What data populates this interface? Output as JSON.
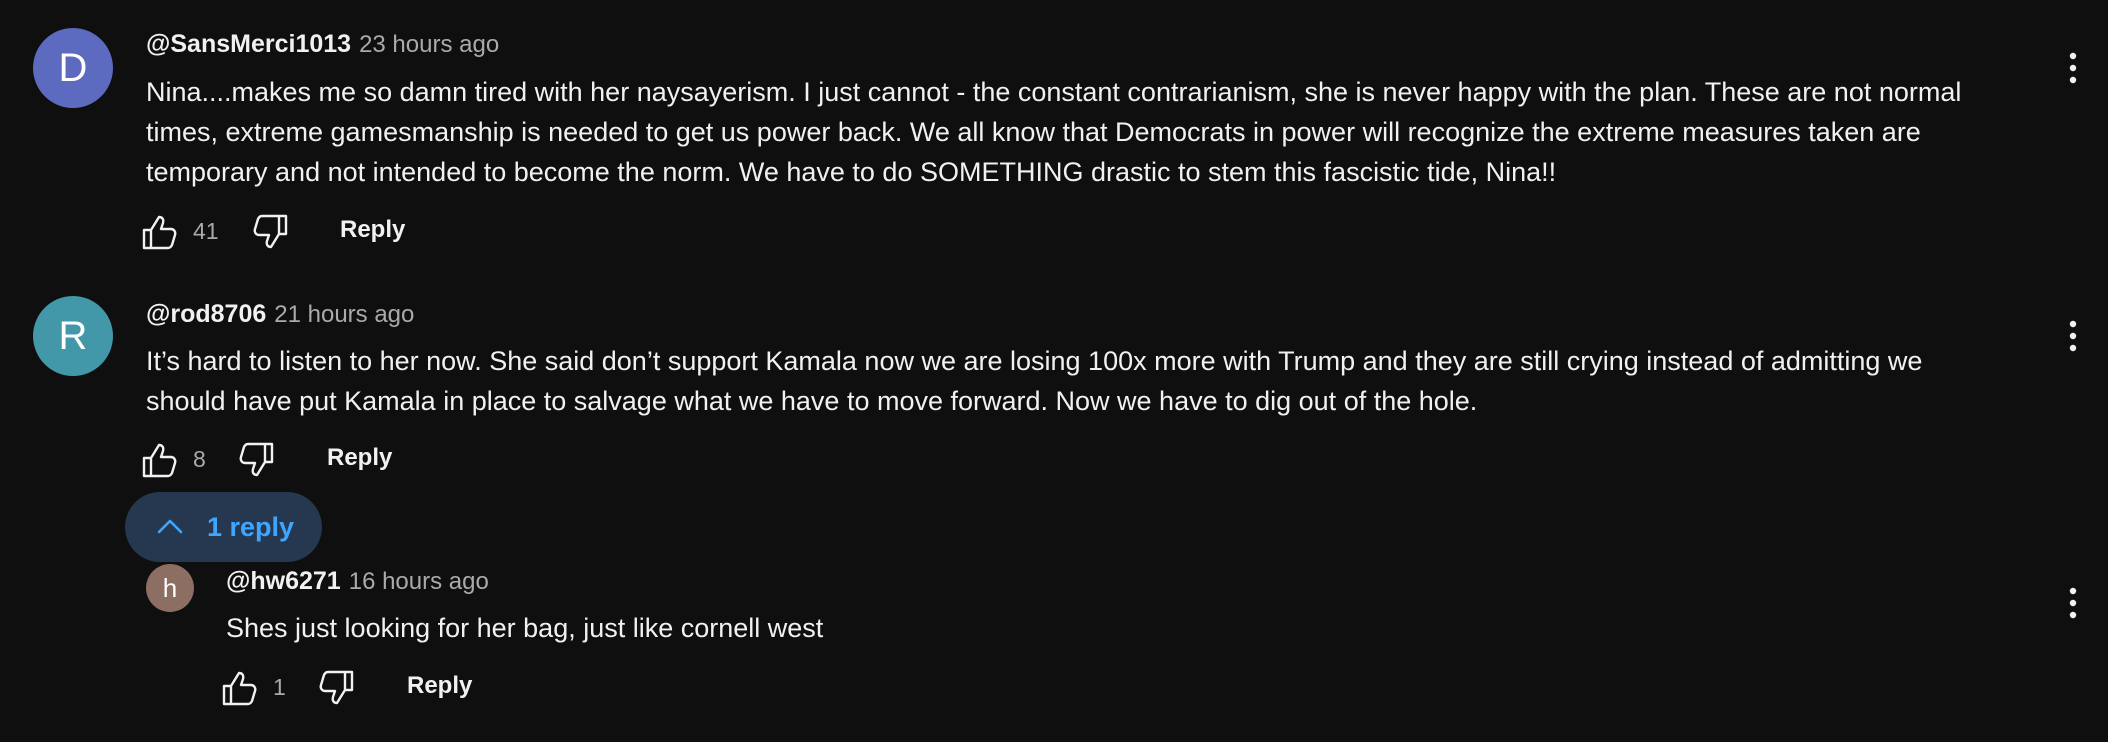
{
  "comments": [
    {
      "avatar_letter": "D",
      "avatar_color": "#5c6bc0",
      "author": "@SansMerci1013",
      "time": "23 hours ago",
      "text_lines": [
        "Nina....makes me so damn tired with her naysayerism. I just cannot - the constant contrarianism, she is never happy with the plan. These are not normal",
        "times, extreme gamesmanship is needed to get us power back. We all know that Democrats in power will recognize the extreme measures taken are",
        "temporary and not intended to become the norm. We have to do SOMETHING drastic to stem this fascistic tide, Nina!!"
      ],
      "likes": "41",
      "reply_label": "Reply"
    },
    {
      "avatar_letter": "R",
      "avatar_color": "#4297a8",
      "author": "@rod8706",
      "time": "21 hours ago",
      "text_lines": [
        "It’s hard to listen to her now. She said don’t support Kamala now we are losing 100x more with Trump and they are still crying instead of admitting we",
        "should have put Kamala in place to salvage what we have to move forward. Now we have to dig out of the hole."
      ],
      "likes": "8",
      "reply_label": "Reply"
    }
  ],
  "replies_toggle": {
    "label": "1 reply",
    "icon": "chevron-up-icon",
    "accent": "#3ea6ff"
  },
  "reply": {
    "avatar_letter": "h",
    "avatar_color": "#8d6e63",
    "author": "@hw6271",
    "time": "16 hours ago",
    "text": "Shes just looking for her bag, just like cornell west",
    "likes": "1",
    "reply_label": "Reply"
  }
}
